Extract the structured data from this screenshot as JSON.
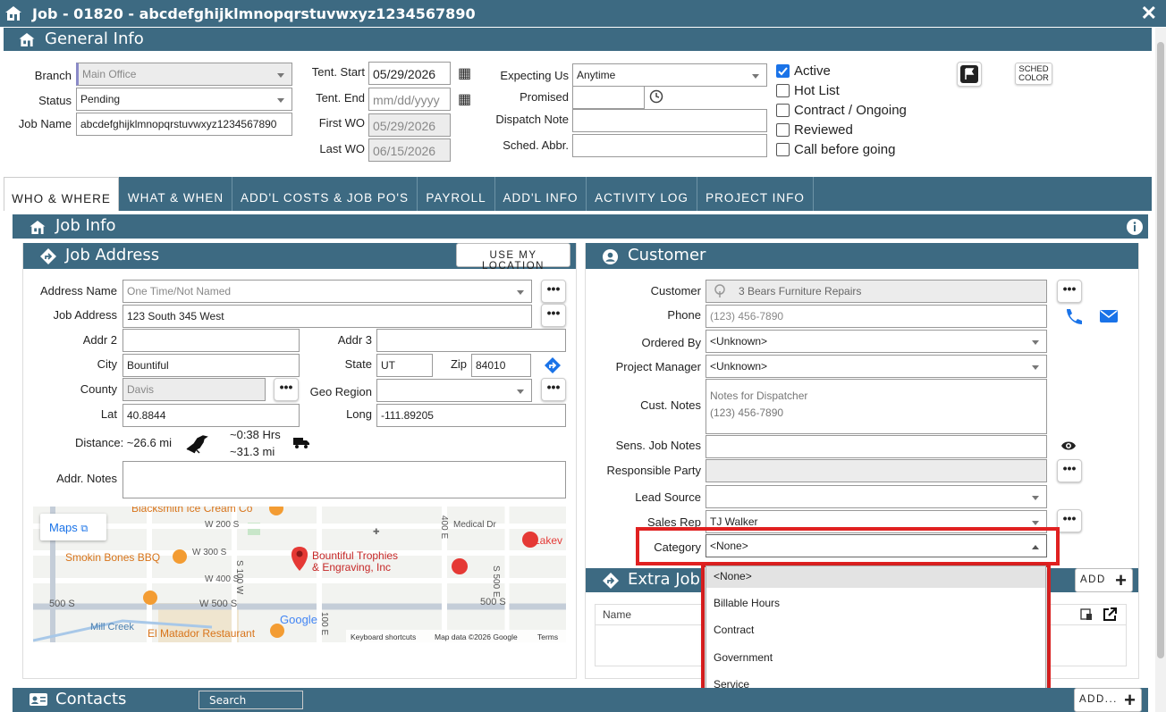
{
  "window": {
    "title": "Job - 01820 - abcdefghijklmnopqrstuvwxyz1234567890"
  },
  "general": {
    "title": "General Info",
    "branch_label": "Branch",
    "branch_value": "Main Office",
    "status_label": "Status",
    "status_value": "Pending",
    "jobname_label": "Job Name",
    "jobname_value": "abcdefghijklmnopqrstuvwxyz1234567890",
    "tent_start_label": "Tent. Start",
    "tent_start_value": "05/29/2026",
    "tent_end_label": "Tent. End",
    "tent_end_value": "mm/dd/yyyy",
    "first_wo_label": "First WO",
    "first_wo_value": "05/29/2026",
    "last_wo_label": "Last WO",
    "last_wo_value": "06/15/2026",
    "expecting_label": "Expecting Us",
    "expecting_value": "Anytime",
    "promised_label": "Promised",
    "dispatch_note_label": "Dispatch Note",
    "sched_abbr_label": "Sched. Abbr.",
    "checkboxes": [
      {
        "label": "Active",
        "checked": true
      },
      {
        "label": "Hot List",
        "checked": false
      },
      {
        "label": "Contract / Ongoing",
        "checked": false
      },
      {
        "label": "Reviewed",
        "checked": false
      },
      {
        "label": "Call before going",
        "checked": false
      }
    ],
    "sched_color_line1": "SCHED",
    "sched_color_line2": "COLOR"
  },
  "tabs": [
    {
      "label": "WHO & WHERE",
      "active": true
    },
    {
      "label": "WHAT & WHEN"
    },
    {
      "label": "ADD'L COSTS & JOB PO'S"
    },
    {
      "label": "PAYROLL"
    },
    {
      "label": "ADD'L INFO"
    },
    {
      "label": "ACTIVITY LOG"
    },
    {
      "label": "PROJECT INFO"
    }
  ],
  "jobinfo": {
    "title": "Job Info"
  },
  "address": {
    "title": "Job Address",
    "use_location_label": "USE MY LOCATION",
    "address_name_label": "Address Name",
    "address_name_placeholder": "One Time/Not Named",
    "job_address_label": "Job Address",
    "job_address_value": "123 South 345 West",
    "addr2_label": "Addr 2",
    "addr3_label": "Addr 3",
    "city_label": "City",
    "city_value": "Bountiful",
    "state_label": "State",
    "state_value": "UT",
    "zip_label": "Zip",
    "zip_value": "84010",
    "county_label": "County",
    "county_value": "Davis",
    "geo_label": "Geo Region",
    "lat_label": "Lat",
    "lat_value": "40.8844",
    "long_label": "Long",
    "long_value": "-111.89205",
    "distance_label": "Distance: ~26.6 mi",
    "drive_time": "~0:38 Hrs",
    "drive_distance": "~31.3 mi",
    "addr_notes_label": "Addr. Notes"
  },
  "map": {
    "maps_link": "Maps",
    "place_name_line1": "Bountiful Trophies",
    "place_name_line2": "& Engraving, Inc",
    "labels": [
      "Blacksmith Ice Cream Co",
      "W 200 S",
      "W 300 S",
      "W 400 S",
      "Smokin Bones BBQ",
      "S 100 W",
      "400 E",
      "Medical Dr",
      "S 500 E",
      "500 S",
      "W 500 S",
      "500 S",
      "Mill Creek",
      "El Matador Restaurant",
      "Lakev",
      "100 E"
    ],
    "footer_keyboard": "Keyboard shortcuts",
    "footer_data": "Map data ©2026 Google",
    "footer_terms": "Terms",
    "google": "Google"
  },
  "customer": {
    "title": "Customer",
    "customer_label": "Customer",
    "customer_value": "3 Bears Furniture Repairs",
    "phone_label": "Phone",
    "phone_value": "(123) 456-7890",
    "ordered_by_label": "Ordered By",
    "ordered_by_value": "<Unknown>",
    "pm_label": "Project Manager",
    "pm_value": "<Unknown>",
    "cust_notes_label": "Cust. Notes",
    "cust_notes_line1": "Notes for Dispatcher",
    "cust_notes_line2": "(123) 456-7890",
    "sens_notes_label": "Sens. Job Notes",
    "responsible_label": "Responsible Party",
    "lead_source_label": "Lead Source",
    "sales_rep_label": "Sales Rep",
    "sales_rep_value": "TJ Walker",
    "category_label": "Category",
    "category_value": "<None>",
    "category_options": [
      "<None>",
      "Billable Hours",
      "Contract",
      "Government",
      "Service"
    ]
  },
  "extra": {
    "title": "Extra Job",
    "add_label": "ADD",
    "name_col": "Name"
  },
  "contacts": {
    "title": "Contacts",
    "search_label": "Search",
    "add_label": "ADD..."
  },
  "colors": {
    "header": "#3d6a82",
    "highlight": "#e02020",
    "accent": "#1a73e8"
  }
}
